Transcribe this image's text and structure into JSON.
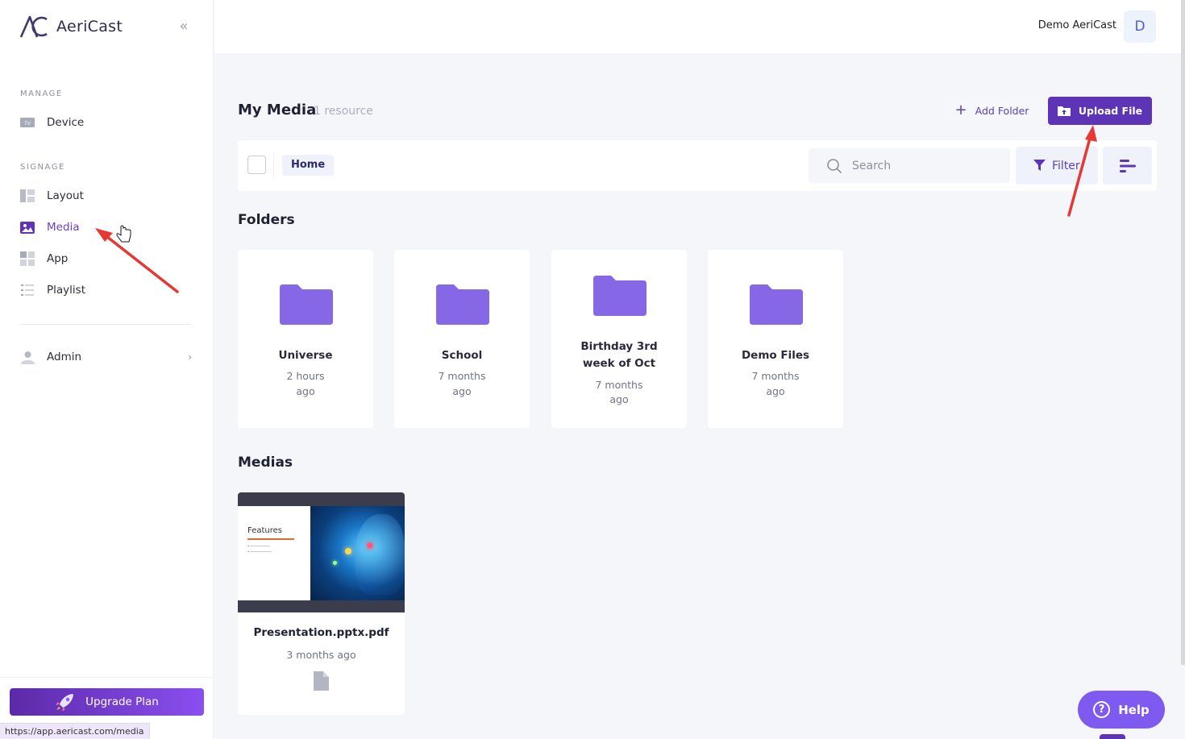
{
  "brand": {
    "name": "AeriCast"
  },
  "sidebar": {
    "sections": [
      {
        "label": "MANAGE"
      },
      {
        "label": "SIGNAGE"
      }
    ],
    "items": [
      {
        "label": "Device",
        "icon": "tv-icon"
      },
      {
        "label": "Layout",
        "icon": "layout-icon"
      },
      {
        "label": "Media",
        "icon": "image-icon",
        "active": true
      },
      {
        "label": "App",
        "icon": "apps-grid-icon"
      },
      {
        "label": "Playlist",
        "icon": "playlist-icon"
      },
      {
        "label": "Admin",
        "icon": "user-icon"
      }
    ],
    "upgrade_label": "Upgrade Plan"
  },
  "status_url": "https://app.aericast.com/media",
  "user": {
    "name": "Demo AeriCast",
    "initial": "D"
  },
  "page": {
    "title": "My Media",
    "count": "1 resource",
    "add_folder_label": "Add Folder",
    "upload_label": "Upload File"
  },
  "toolbar": {
    "breadcrumb": "Home",
    "search_placeholder": "Search",
    "filter_label": "Filter"
  },
  "folders_title": "Folders",
  "folders": [
    {
      "name": "Universe",
      "time_line1": "2 hours",
      "time_line2": "ago"
    },
    {
      "name": "School",
      "time_line1": "7 months",
      "time_line2": "ago"
    },
    {
      "name_line1": "Birthday 3rd",
      "name_line2": "week of Oct",
      "time_line1": "7 months",
      "time_line2": "ago"
    },
    {
      "name": "Demo Files",
      "time_line1": "7 months",
      "time_line2": "ago"
    }
  ],
  "medias_title": "Medias",
  "medias": [
    {
      "name": "Presentation.pptx.pdf",
      "time": "3 months ago",
      "slide_title": "Features"
    }
  ],
  "help_label": "Help",
  "colors": {
    "accent": "#5e34b7",
    "folder": "#8667e6",
    "help": "#7f5af0",
    "annotation": "#e53935"
  }
}
